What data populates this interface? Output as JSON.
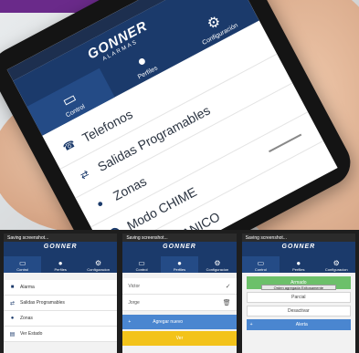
{
  "hero": {
    "status_icons": "▣ ▲ ⊟ ◀ ✈ ▮ ▮",
    "logo": "GONNER",
    "logo_sub": "ALARMAS",
    "nav": [
      {
        "icon": "monitor-icon",
        "label": "Control"
      },
      {
        "icon": "user-icon",
        "label": "Perfiles"
      },
      {
        "icon": "gear-icon",
        "label": "Configuración"
      }
    ],
    "menu": [
      {
        "icon": "phone-icon",
        "label": "Telefonos"
      },
      {
        "icon": "shuffle-icon",
        "label": "Salidas Programables"
      },
      {
        "icon": "pin-icon",
        "label": "Zonas"
      },
      {
        "icon": "radio-icon",
        "label": "Modo CHIME"
      },
      {
        "icon": "",
        "label": "Modo PANICO"
      }
    ]
  },
  "thumbs": {
    "status_text": "Saving screenshot...",
    "logo": "GONNER",
    "nav": [
      {
        "icon": "monitor-icon",
        "label": "Control"
      },
      {
        "icon": "user-icon",
        "label": "Perfiles"
      },
      {
        "icon": "gear-icon",
        "label": "Configuracion"
      }
    ],
    "menu": [
      {
        "icon": "alarm-icon",
        "label": "Alarma"
      },
      {
        "icon": "shuffle-icon",
        "label": "Salidas Programables"
      },
      {
        "icon": "pin-icon",
        "label": "Zonas"
      },
      {
        "icon": "doc-icon",
        "label": "Ver Estado"
      }
    ],
    "users": [
      {
        "name": "Victor",
        "end": "✓"
      },
      {
        "name": "Jorge",
        "end": "🗑"
      }
    ],
    "add_label": "Agregar nuevo",
    "yellow_label": "Ver",
    "green_label": "Armado",
    "toast": "Orden agregada Exitosamente",
    "buttons": [
      "Parcial",
      "Desactivar"
    ],
    "blue_label": "Alerta"
  }
}
